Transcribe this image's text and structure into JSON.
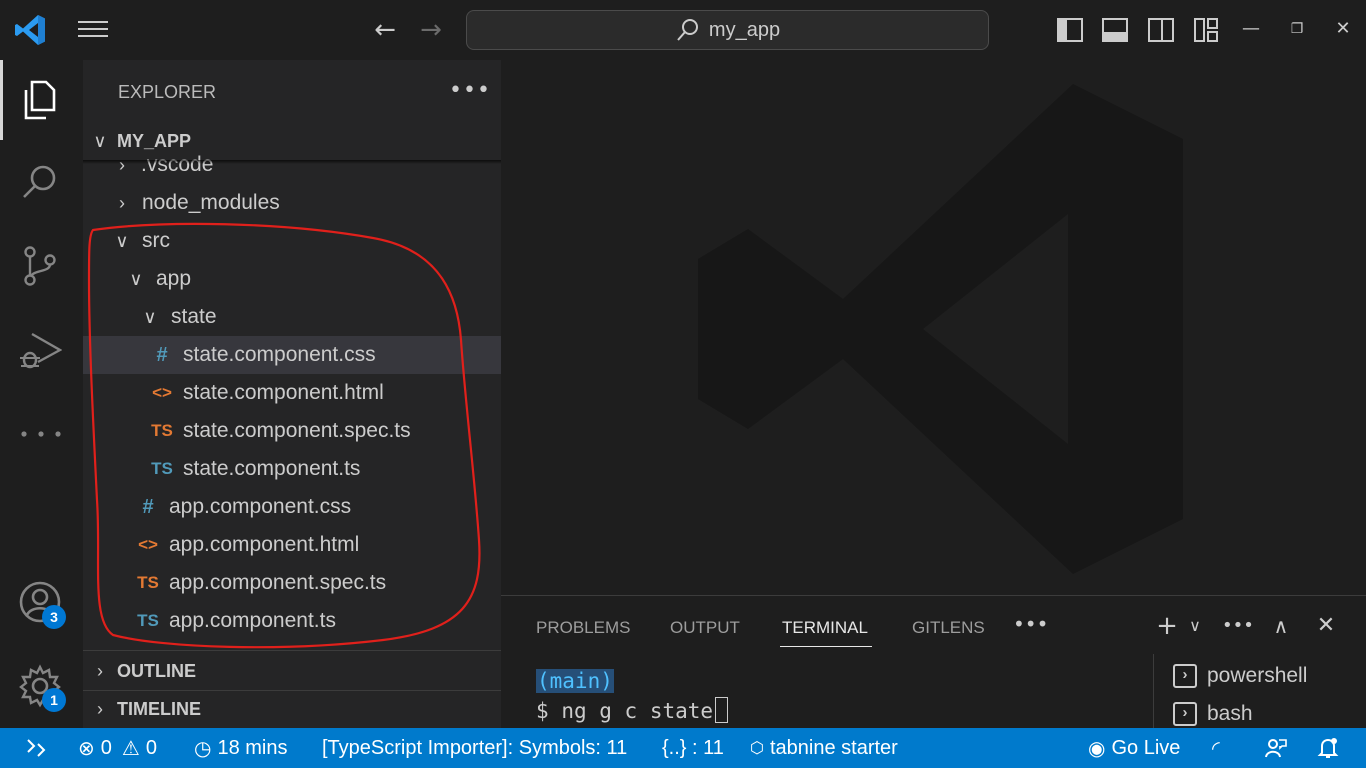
{
  "titlebar": {
    "search_text": "my_app",
    "back_icon": "arrow-left-icon",
    "forward_icon": "arrow-right-icon"
  },
  "activity": {
    "items": [
      "explorer-icon",
      "search-icon",
      "source-control-icon",
      "run-debug-icon",
      "more-icon"
    ],
    "accounts_badge": "3",
    "manage_badge": "1"
  },
  "sidebar": {
    "title": "EXPLORER",
    "project": "MY_APP",
    "tree": [
      {
        "label": ".vscode",
        "type": "folder",
        "expanded": false
      },
      {
        "label": "node_modules",
        "type": "folder",
        "expanded": false
      },
      {
        "label": "src",
        "type": "folder",
        "expanded": true
      },
      {
        "label": "app",
        "type": "folder",
        "expanded": true
      },
      {
        "label": "state",
        "type": "folder",
        "expanded": true
      },
      {
        "label": "state.component.css",
        "type": "css",
        "icon": "#"
      },
      {
        "label": "state.component.html",
        "type": "html",
        "icon": "<>"
      },
      {
        "label": "state.component.spec.ts",
        "type": "spec",
        "icon": "TS"
      },
      {
        "label": "state.component.ts",
        "type": "ts",
        "icon": "TS"
      },
      {
        "label": "app.component.css",
        "type": "css",
        "icon": "#"
      },
      {
        "label": "app.component.html",
        "type": "html",
        "icon": "<>"
      },
      {
        "label": "app.component.spec.ts",
        "type": "spec",
        "icon": "TS"
      },
      {
        "label": "app.component.ts",
        "type": "ts",
        "icon": "TS"
      }
    ],
    "outline": "OUTLINE",
    "timeline": "TIMELINE"
  },
  "panel": {
    "tabs": [
      "PROBLEMS",
      "OUTPUT",
      "TERMINAL",
      "GITLENS"
    ],
    "active_tab": "TERMINAL",
    "terminal": {
      "branch": "(main)",
      "prompt": "$",
      "command": "ng g c state"
    },
    "terminals": [
      "powershell",
      "bash"
    ]
  },
  "statusbar": {
    "errors": "0",
    "warnings": "0",
    "time": "18 mins",
    "ts_importer": "[TypeScript Importer]: Symbols: 11",
    "braces": "{..} : 11",
    "tabnine": "tabnine starter",
    "golive": "Go Live"
  },
  "colors": {
    "accent": "#007acc",
    "badge": "#0078d4",
    "css_icon": "#519aba",
    "html_icon": "#e37933",
    "annotation": "#e0201b"
  }
}
